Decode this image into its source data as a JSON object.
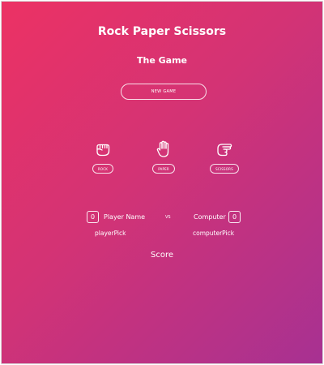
{
  "title": "Rock Paper Scissors",
  "subtitle": "The Game",
  "new_game_label": "NEW GAME",
  "choices": [
    {
      "label": "ROCK",
      "icon": "rock-hand-icon"
    },
    {
      "label": "PAPER",
      "icon": "paper-hand-icon"
    },
    {
      "label": "SCISSORS",
      "icon": "scissors-hand-icon"
    }
  ],
  "player": {
    "score": "0",
    "name": "Player Name",
    "pick": "playerPick"
  },
  "vs": "VS",
  "computer": {
    "score": "0",
    "name": "Computer",
    "pick": "computerPick"
  },
  "score_label": "Score",
  "colors": {
    "gradient_start": "#ec3264",
    "gradient_mid": "#d33375",
    "gradient_end": "#a73192",
    "text": "#ffffff"
  }
}
